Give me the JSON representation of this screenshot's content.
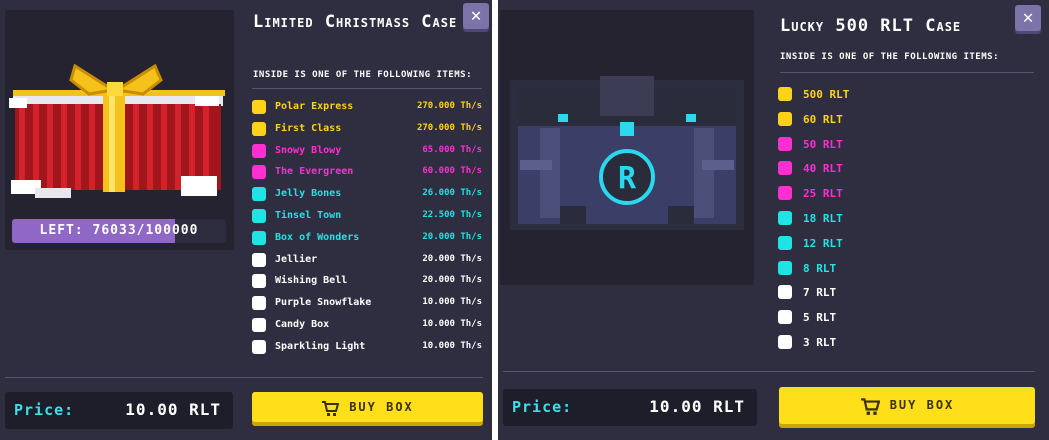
{
  "colors": {
    "gold": "#ffd21a",
    "pink": "#ff2fd2",
    "cyan": "#20e3e3",
    "white": "#ffffff",
    "accent_price": "#3de0ea",
    "buy_button": "#ffdf1a",
    "progress": "#8f68c7"
  },
  "cards": [
    {
      "title": "Limited Christmass Case",
      "subtitle": "Inside is one of the following items:",
      "image_icon": "gift-box-icon",
      "left_label": "LEFT: 76033/100000",
      "left_remaining": 76033,
      "left_total": 100000,
      "items": [
        {
          "name": "Polar Express",
          "value": "270.000 Th/s",
          "color": "#ffd21a"
        },
        {
          "name": "First Class",
          "value": "270.000 Th/s",
          "color": "#ffd21a"
        },
        {
          "name": "Snowy Blowy",
          "value": "65.000 Th/s",
          "color": "#ff2fd2"
        },
        {
          "name": "The Evergreen",
          "value": "60.000 Th/s",
          "color": "#ff2fd2"
        },
        {
          "name": "Jelly Bones",
          "value": "26.000 Th/s",
          "color": "#20e3e3"
        },
        {
          "name": "Tinsel Town",
          "value": "22.500 Th/s",
          "color": "#20e3e3"
        },
        {
          "name": "Box of Wonders",
          "value": "20.000 Th/s",
          "color": "#20e3e3"
        },
        {
          "name": "Jellier",
          "value": "20.000 Th/s",
          "color": "#ffffff"
        },
        {
          "name": "Wishing Bell",
          "value": "20.000 Th/s",
          "color": "#ffffff"
        },
        {
          "name": "Purple Snowflake",
          "value": "10.000 Th/s",
          "color": "#ffffff"
        },
        {
          "name": "Candy Box",
          "value": "10.000 Th/s",
          "color": "#ffffff"
        },
        {
          "name": "Sparkling Light",
          "value": "10.000 Th/s",
          "color": "#ffffff"
        }
      ],
      "price_label": "Price:",
      "price_value": "10.00 RLT",
      "buy_label": "BUY BOX"
    },
    {
      "title": "Lucky 500 RLT Case",
      "subtitle": "Inside is one of the following items:",
      "image_icon": "rlt-chest-icon",
      "items": [
        {
          "name": "500 RLT",
          "color": "#ffd21a"
        },
        {
          "name": "60 RLT",
          "color": "#ffd21a"
        },
        {
          "name": "50 RLT",
          "color": "#ff2fd2"
        },
        {
          "name": "40 RLT",
          "color": "#ff2fd2"
        },
        {
          "name": "25 RLT",
          "color": "#ff2fd2"
        },
        {
          "name": "18 RLT",
          "color": "#20e3e3"
        },
        {
          "name": "12 RLT",
          "color": "#20e3e3"
        },
        {
          "name": "8 RLT",
          "color": "#20e3e3"
        },
        {
          "name": "7 RLT",
          "color": "#ffffff"
        },
        {
          "name": "5 RLT",
          "color": "#ffffff"
        },
        {
          "name": "3 RLT",
          "color": "#ffffff"
        }
      ],
      "price_label": "Price:",
      "price_value": "10.00 RLT",
      "buy_label": "BUY BOX"
    }
  ]
}
